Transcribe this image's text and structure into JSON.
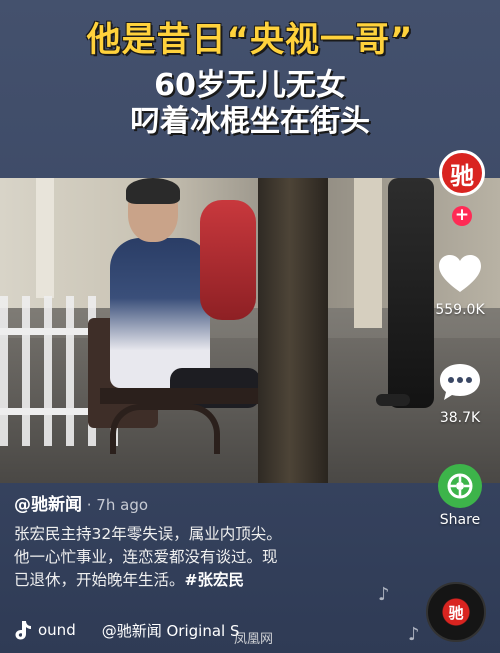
{
  "overlay": {
    "line1": "他是昔日“央视一哥”",
    "line2": "60岁无儿无女",
    "line3": "叼着冰棍坐在街头"
  },
  "rail": {
    "avatar_glyph": "驰",
    "follow_glyph": "+",
    "likes": "559.0K",
    "comments": "38.7K",
    "share": "Share"
  },
  "post": {
    "author": "@驰新闻",
    "time": " · 7h ago",
    "description_lines": [
      "张宏民主持32年零失误，属业内顶尖。",
      "他一心忙事业，连恋爱都没有谈过。现",
      "已退休，开始晚年生活。"
    ],
    "hashtag": "#张宏民",
    "sound_left": "ound",
    "sound_right": "@驰新闻 Original S"
  },
  "watermark": "凤凰网",
  "music_disc_glyph": "驰",
  "colors": {
    "headline_yellow": "#ffd23c",
    "brand_red": "#d92420",
    "share_green": "#3db44a",
    "follow_pink": "#ff2b55"
  },
  "icons": [
    "heart-icon",
    "comment-icon",
    "share-icon",
    "music-note-icon",
    "music-disc-icon"
  ]
}
